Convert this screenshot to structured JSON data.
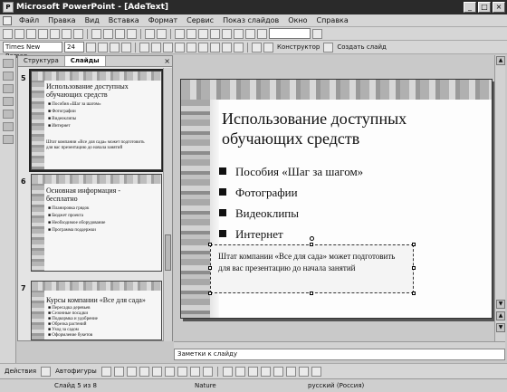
{
  "window": {
    "title": "Microsoft PowerPoint - [AdeText]"
  },
  "window_buttons": [
    "_",
    "□",
    "×"
  ],
  "menu": [
    "Файл",
    "Правка",
    "Вид",
    "Вставка",
    "Формат",
    "Сервис",
    "Показ слайдов",
    "Окно",
    "Справка"
  ],
  "format_toolbar": {
    "font": "Times New Roman",
    "size": "24",
    "designer_label": "Конструктор",
    "new_slide_label": "Создать слайд"
  },
  "pane": {
    "tabs": [
      "Структура",
      "Слайды"
    ],
    "active_tab": "Слайды",
    "slides": [
      {
        "num": "5",
        "title": "Использование доступных обучающих средств",
        "bullets": [
          "Пособия «Шаг за шагом»",
          "Фотографии",
          "Видеоклипы",
          "Интернет"
        ],
        "note": "Штат компании «Все для сада» может подготовить для вас презентацию до начала занятий"
      },
      {
        "num": "6",
        "title": "Основная информация - бесплатно",
        "bullets": [
          "Планировка грядок",
          "Бюджет проекта",
          "Необходимое оборудование",
          "Программа поддержки"
        ]
      },
      {
        "num": "7",
        "title": "Курсы компании «Все для сада»",
        "bullets": [
          "Пересадка деревьев",
          "Сезонные посадки",
          "Подкормка и удобрение",
          "Обрезка растений",
          "Уход за садом",
          "Оформление букетов"
        ]
      }
    ]
  },
  "slide": {
    "title": "Использование доступных обучающих средств",
    "bullets": [
      "Пособия «Шаг за шагом»",
      "Фотографии",
      "Видеоклипы",
      "Интернет"
    ],
    "textbox": "Штат компании «Все для сада» может подготовить для вас презентацию до начала занятий"
  },
  "notes": {
    "placeholder": "Заметки к слайду"
  },
  "drawbar": {
    "actions_label": "Действия",
    "autoshapes_label": "Автофигуры"
  },
  "status": {
    "slide": "Слайд 5 из 8",
    "design": "Nature",
    "language": "русский (Россия)"
  }
}
